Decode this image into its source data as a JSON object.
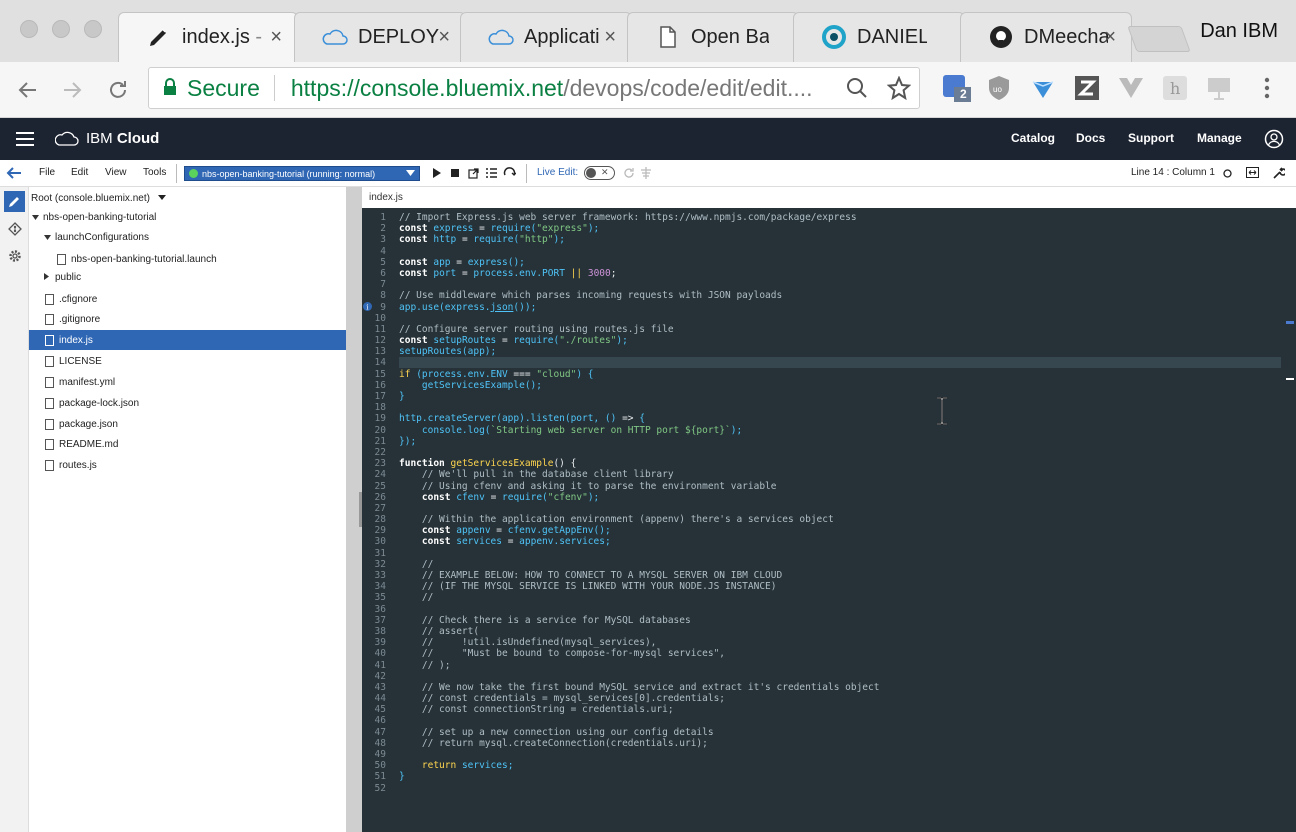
{
  "browser": {
    "tabs": [
      {
        "title": "index.js",
        "suffix": " -",
        "icon": "pencil-icon"
      },
      {
        "title": "DEPLOY",
        "icon": "cloud-icon"
      },
      {
        "title": "Applicati",
        "icon": "cloud-icon"
      },
      {
        "title": "Open Ba",
        "icon": "document-icon"
      },
      {
        "title": "DANIEL M",
        "icon": "circle-logo-icon"
      },
      {
        "title": "DMeecha",
        "icon": "github-icon"
      }
    ],
    "close_glyph": "×",
    "user": "Dan IBM",
    "secure_label": "Secure",
    "url_scheme_host": "https://console.bluemix.net",
    "url_path": "/devops/code/edit/edit....",
    "extension_badge": "2"
  },
  "header": {
    "brand_prefix": "IBM",
    "brand_suffix": "Cloud",
    "nav": [
      "Catalog",
      "Docs",
      "Support",
      "Manage"
    ]
  },
  "toolbar": {
    "menus": [
      "File",
      "Edit",
      "View",
      "Tools"
    ],
    "project": "nbs-open-banking-tutorial (running: normal)",
    "live_edit": "Live Edit:",
    "position": "Line 14 : Column 1"
  },
  "tree": {
    "root": "Root (console.bluemix.net)",
    "project": "nbs-open-banking-tutorial",
    "launch_folder": "launchConfigurations",
    "launch_file": "nbs-open-banking-tutorial.launch",
    "public_folder": "public",
    "files": [
      ".cfignore",
      ".gitignore",
      "index.js",
      "LICENSE",
      "manifest.yml",
      "package-lock.json",
      "package.json",
      "README.md",
      "routes.js"
    ]
  },
  "editor": {
    "filename": "index.js",
    "line_count": 52
  },
  "colors": {
    "ibm_header": "#1c2331",
    "editor_bg": "#263238",
    "selection": "#2f67b5",
    "secure_green": "#0b8043"
  }
}
